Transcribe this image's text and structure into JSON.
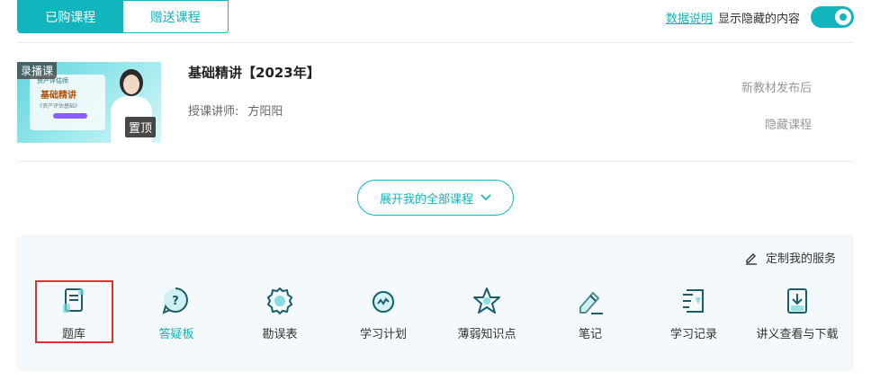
{
  "tabs": [
    {
      "label": "已购课程",
      "active": true
    },
    {
      "label": "赠送课程",
      "active": false
    }
  ],
  "header": {
    "data_link": "数据说明",
    "toggle_label": "显示隐藏的内容",
    "toggle_on": true
  },
  "course": {
    "badge_live": "录播课",
    "badge_top": "置顶",
    "title": "基础精讲【2023年】",
    "teacher_label": "授课讲师:",
    "teacher_name": "方阳阳",
    "status_text": "新教材发布后",
    "hide_label": "隐藏课程",
    "thumb_small1": "资产评估师",
    "thumb_title": "基础精讲",
    "thumb_small2": "《资产评估基础》"
  },
  "expand": {
    "label": "展开我的全部课程"
  },
  "services": {
    "custom_label": "定制我的服务",
    "items": [
      {
        "label": "题库",
        "icon": "question-bank-icon"
      },
      {
        "label": "答疑板",
        "icon": "qa-board-icon"
      },
      {
        "label": "勘误表",
        "icon": "errata-icon"
      },
      {
        "label": "学习计划",
        "icon": "study-plan-icon"
      },
      {
        "label": "薄弱知识点",
        "icon": "weak-points-icon"
      },
      {
        "label": "笔记",
        "icon": "notes-icon"
      },
      {
        "label": "学习记录",
        "icon": "study-record-icon"
      },
      {
        "label": "讲义查看与下载",
        "icon": "handout-download-icon"
      }
    ]
  },
  "colors": {
    "accent": "#12b5bd",
    "highlight": "#e0312f"
  }
}
